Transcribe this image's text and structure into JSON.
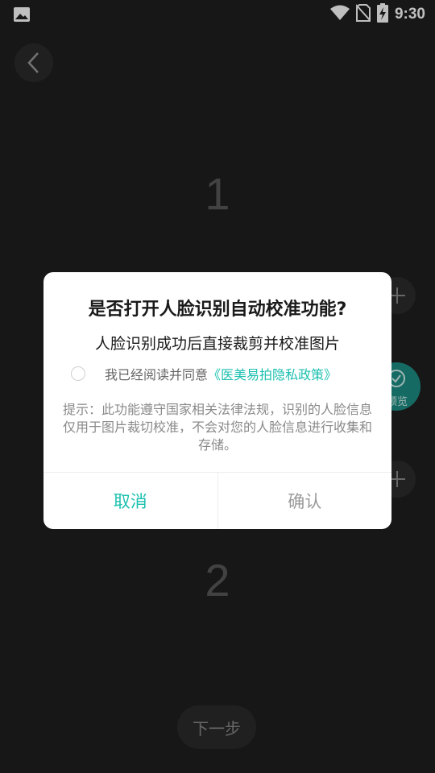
{
  "status_bar": {
    "time": "9:30",
    "icons": [
      "image-icon",
      "wifi-icon",
      "no-sim-icon",
      "battery-charging-icon"
    ]
  },
  "background": {
    "step_top": "1",
    "step_bottom": "2",
    "preview_label": "预览",
    "next_label": "下一步"
  },
  "dialog": {
    "title": "是否打开人脸识别自动校准功能?",
    "subtitle": "人脸识别成功后直接裁剪并校准图片",
    "agree_text": "我已经阅读并同意",
    "policy_link": "《医美易拍隐私政策》",
    "agree_checked": false,
    "notice": "提示：此功能遵守国家相关法律法规，识别的人脸信息仅用于图片裁切校准，不会对您的人脸信息进行收集和存储。",
    "cancel_label": "取消",
    "confirm_label": "确认"
  },
  "colors": {
    "accent": "#1cc0b0",
    "background": "#1f1f1f",
    "dialog_bg": "#ffffff"
  }
}
